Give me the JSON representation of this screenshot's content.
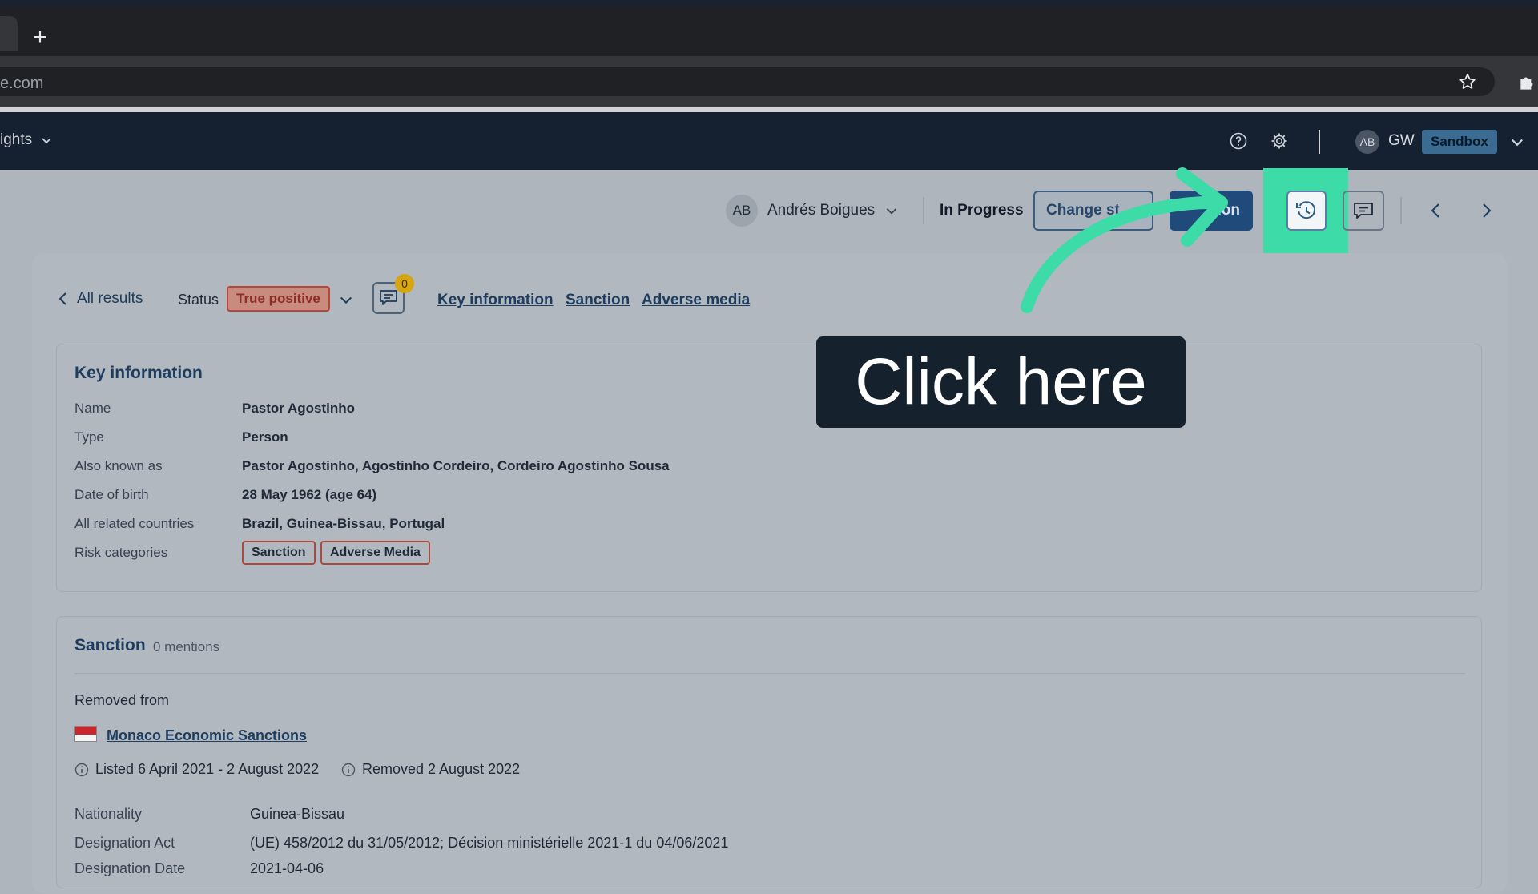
{
  "browser": {
    "url": "e.com"
  },
  "app_header": {
    "nav_label": "ights",
    "user_avatar": "AB",
    "user_initials": "GW",
    "environment": "Sandbox"
  },
  "toolbar": {
    "assignee_avatar": "AB",
    "assignee_name": "Andrés Boigues",
    "case_status": "In Progress",
    "change_status_label": "Change st",
    "action_label": "ion"
  },
  "subnav": {
    "back_label": "All results",
    "status_label": "Status",
    "status_value": "True positive",
    "comments_count": "0",
    "links": [
      "Key information",
      "Sanction",
      "Adverse media"
    ]
  },
  "key_information": {
    "title": "Key information",
    "rows": [
      {
        "label": "Name",
        "value": "Pastor Agostinho"
      },
      {
        "label": "Type",
        "value": "Person"
      },
      {
        "label": "Also known as",
        "value": "Pastor Agostinho, Agostinho Cordeiro, Cordeiro Agostinho Sousa"
      },
      {
        "label": "Date of birth",
        "value": "28 May 1962 (age 64)"
      },
      {
        "label": "All related countries",
        "value": "Brazil, Guinea-Bissau, Portugal"
      },
      {
        "label": "Risk categories",
        "value": ""
      }
    ],
    "risk_categories": [
      "Sanction",
      "Adverse Media"
    ]
  },
  "sanction": {
    "title": "Sanction",
    "mentions": "0 mentions",
    "removed_from_label": "Removed from",
    "list_name": "Monaco Economic Sanctions",
    "listed": "Listed 6 April 2021 - 2 August 2022",
    "removed": "Removed 2 August 2022",
    "details": [
      {
        "label": "Nationality",
        "value": "Guinea-Bissau"
      },
      {
        "label": "Designation Act",
        "value": "(UE) 458/2012 du 31/05/2012; Décision ministérielle 2021-1 du 04/06/2021"
      },
      {
        "label": "Designation Date",
        "value": "2021-04-06"
      }
    ]
  },
  "annotation": {
    "tooltip": "Click here",
    "highlight_color": "#3ddba8"
  }
}
